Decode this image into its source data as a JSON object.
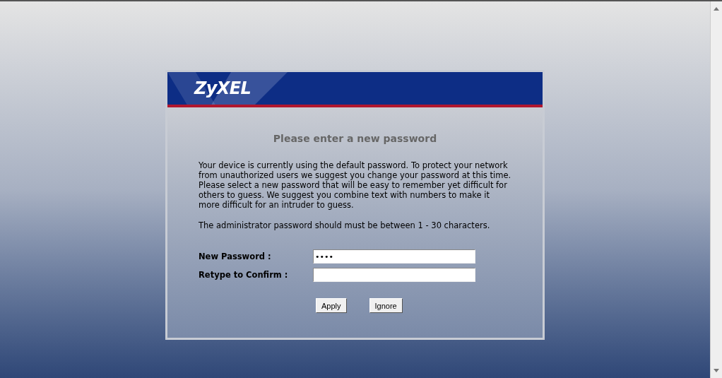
{
  "header": {
    "logo": "ZyXEL"
  },
  "title": "Please enter a new password",
  "intro": "Your device is currently using the default password. To protect your network from unauthorized users we suggest you change your password at this time. Please select a new password that will be easy to remember yet difficult for others to guess. We suggest you combine text with numbers to make it more difficult for an intruder to guess.",
  "rule": "The administrator password should must be between 1 - 30 characters.",
  "fields": [
    {
      "label": "New Password :",
      "value": "••••"
    },
    {
      "label": "Retype to Confirm :"
    }
  ],
  "buttons": [
    "Apply",
    "Ignore"
  ]
}
